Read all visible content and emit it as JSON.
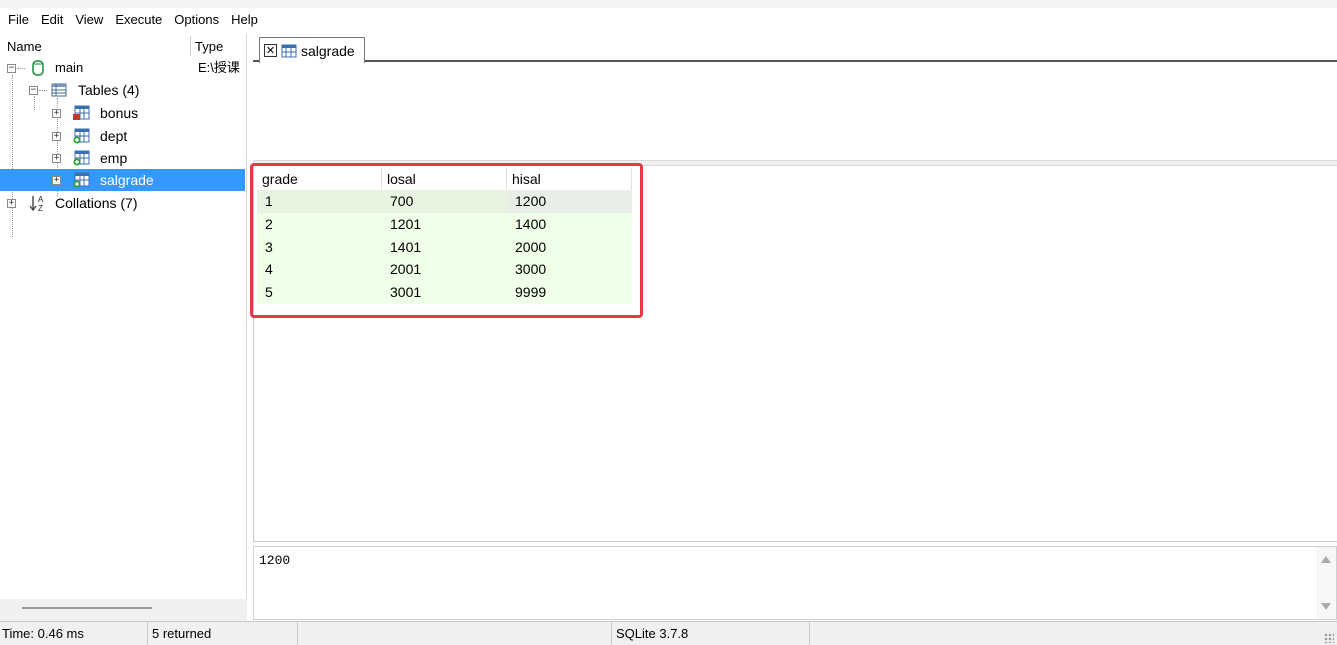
{
  "menu": [
    "File",
    "Edit",
    "View",
    "Execute",
    "Options",
    "Help"
  ],
  "tree": {
    "header_name": "Name",
    "header_type": "Type",
    "db_name": "main",
    "db_type": "E:\\授课",
    "tables_label": "Tables (4)",
    "tables": [
      "bonus",
      "dept",
      "emp",
      "salgrade"
    ],
    "selected_table": "salgrade",
    "collations_label": "Collations (7)"
  },
  "tab": {
    "label": "salgrade",
    "close_glyph": "✕"
  },
  "grid": {
    "columns": [
      "grade",
      "losal",
      "hisal"
    ],
    "rows": [
      [
        "1",
        "700",
        "1200"
      ],
      [
        "2",
        "1201",
        "1400"
      ],
      [
        "3",
        "1401",
        "2000"
      ],
      [
        "4",
        "2001",
        "3000"
      ],
      [
        "5",
        "3001",
        "9999"
      ]
    ]
  },
  "value_viewer": {
    "text": "1200"
  },
  "status": {
    "time": "Time: 0.46 ms",
    "returned": "5 returned",
    "engine": "SQLite 3.7.8"
  },
  "colors": {
    "selection": "#3399ff",
    "highlight_box": "#e63946",
    "grid_row_bg": "#f0ffe8"
  }
}
